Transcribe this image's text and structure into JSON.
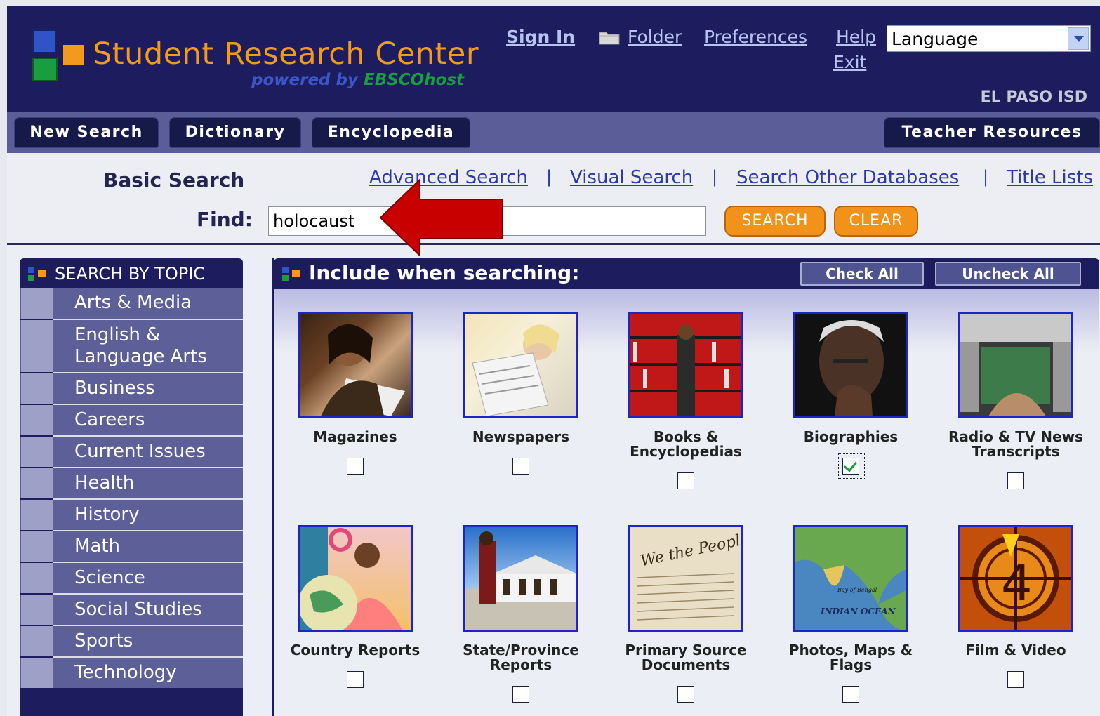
{
  "header": {
    "title": "Student Research Center",
    "powered_by": "powered by",
    "powered_brand": "EBSCOhost",
    "links": {
      "sign_in": "Sign In",
      "folder": "Folder",
      "preferences": "Preferences",
      "help": "Help",
      "exit": "Exit"
    },
    "language_select": {
      "value": "Language"
    },
    "district": "EL PASO ISD"
  },
  "nav": {
    "new_search": "New Search",
    "dictionary": "Dictionary",
    "encyclopedia": "Encyclopedia",
    "teacher_resources": "Teacher Resources"
  },
  "search": {
    "mode": "Basic Search",
    "links": {
      "advanced": "Advanced Search",
      "visual": "Visual Search",
      "other_databases": "Search Other Databases",
      "title_lists": "Title Lists",
      "separator": "|"
    },
    "find_label": "Find:",
    "query": "holocaust",
    "search_button": "SEARCH",
    "clear_button": "CLEAR"
  },
  "sidebar": {
    "heading": "SEARCH BY TOPIC",
    "topics": [
      "Arts & Media",
      "English &",
      "Language Arts",
      "Business",
      "Careers",
      "Current Issues",
      "Health",
      "History",
      "Math",
      "Science",
      "Social Studies",
      "Sports",
      "Technology"
    ]
  },
  "include": {
    "heading": "Include when searching:",
    "check_all": "Check All",
    "uncheck_all": "Uncheck All",
    "sources": [
      {
        "line1": "Magazines",
        "line2": "",
        "checked": false
      },
      {
        "line1": "Newspapers",
        "line2": "",
        "checked": false
      },
      {
        "line1": "Books &",
        "line2": "Encyclopedias",
        "checked": false
      },
      {
        "line1": "Biographies",
        "line2": "",
        "checked": true
      },
      {
        "line1": "Radio & TV News",
        "line2": "Transcripts",
        "checked": false
      },
      {
        "line1": "Country Reports",
        "line2": "",
        "checked": false
      },
      {
        "line1": "State/Province",
        "line2": "Reports",
        "checked": false
      },
      {
        "line1": "Primary Source",
        "line2": "Documents",
        "checked": false
      },
      {
        "line1": "Photos, Maps &",
        "line2": "Flags",
        "checked": false
      },
      {
        "line1": "Film & Video",
        "line2": "",
        "checked": false
      }
    ]
  },
  "images": {
    "we_the_people": "We the People",
    "bay_of_bengal": "Bay of Bengal",
    "indian_ocean": "INDIAN OCEAN",
    "countdown": "4"
  },
  "colors": {
    "header_bg": "#1c1c5e",
    "title_orange": "#f29a1d",
    "nav_bar": "#5a5d98",
    "button_orange": "#f29218",
    "annotation_arrow": "#c80000"
  }
}
